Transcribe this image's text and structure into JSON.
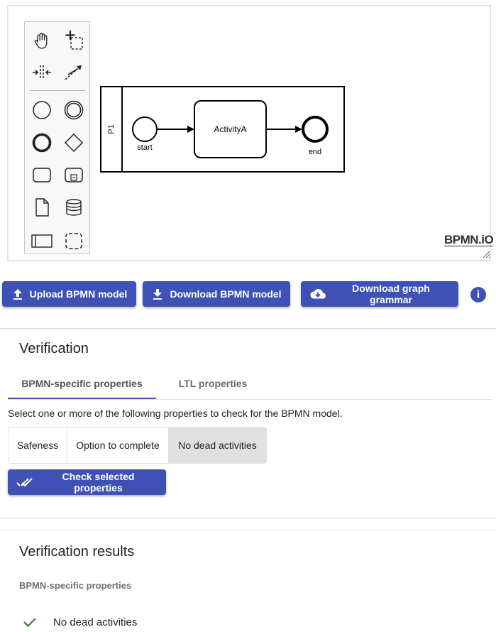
{
  "palette": {
    "tools": [
      {
        "name": "hand-tool-icon"
      },
      {
        "name": "lasso-tool-icon"
      },
      {
        "name": "space-tool-icon"
      },
      {
        "name": "global-connect-tool-icon"
      },
      {
        "name": "start-event-icon"
      },
      {
        "name": "intermediate-event-icon"
      },
      {
        "name": "end-event-icon"
      },
      {
        "name": "gateway-icon"
      },
      {
        "name": "task-icon"
      },
      {
        "name": "subprocess-icon"
      },
      {
        "name": "data-object-icon"
      },
      {
        "name": "data-store-icon"
      },
      {
        "name": "participant-icon"
      },
      {
        "name": "group-icon"
      }
    ]
  },
  "diagram": {
    "pool_label": "P1",
    "start_label": "start",
    "task_label": "ActivityA",
    "end_label": "end"
  },
  "logo": "BPMN.iO",
  "actions": {
    "upload_label": "Upload BPMN model",
    "download_label": "Download BPMN model",
    "grammar_label": "Download graph grammar",
    "info_label": "i"
  },
  "verification": {
    "title": "Verification",
    "tabs": [
      "BPMN-specific properties",
      "LTL properties"
    ],
    "description": "Select one or more of the following properties to check for the BPMN model.",
    "options": [
      {
        "label": "Safeness",
        "selected": false
      },
      {
        "label": "Option to complete",
        "selected": false
      },
      {
        "label": "No dead activities",
        "selected": true
      }
    ],
    "check_label": "Check selected properties"
  },
  "results": {
    "title": "Verification results",
    "subtitle": "BPMN-specific properties",
    "items": [
      {
        "label": "No dead activities",
        "status": "passed"
      }
    ]
  },
  "colors": {
    "accent": "#3f51b5",
    "success": "#2e7d32"
  }
}
